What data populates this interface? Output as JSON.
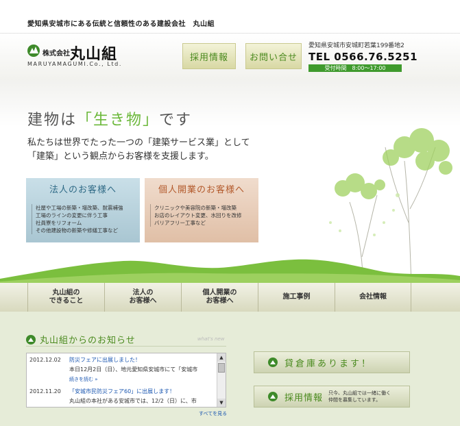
{
  "tagline": "愛知県安城市にある伝統と信頼性のある建設会社　丸山組",
  "logo": {
    "prefix": "株式会社",
    "name": "丸山組",
    "roman": "MARUYAMAGUMI.Co., Ltd."
  },
  "header": {
    "recruit_label": "採用情報",
    "contact_label": "お問い合せ",
    "address": "愛知県安城市安城町若葉199番地2",
    "tel": "TEL 0566.76.5251",
    "hours": "受付時間　8:00～17:00"
  },
  "hero": {
    "headline_before": "建物は",
    "headline_accent": "「生き物」",
    "headline_after": "です",
    "text_line1": "私たちは世界でたった一つの「建築サービス業」として",
    "text_line2": "「建築」という観点からお客様を支援します。"
  },
  "panels": {
    "corp": {
      "title": "法人のお客様へ",
      "items": [
        "社屋や工場の新築・増改築、耐震補強",
        "工場のラインの変更に伴う工事",
        "社員寮をリフォーム",
        "その他建設物の新築や修繕工事など"
      ]
    },
    "indiv": {
      "title": "個人開業のお客様へ",
      "items": [
        "クリニックや美容院の新築・増改築",
        "お店のレイアウト変更、水回りを改修",
        "バリアフリー工事など"
      ]
    }
  },
  "nav": [
    {
      "line1": "丸山組の",
      "line2": "できること"
    },
    {
      "line1": "法人の",
      "line2": "お客様へ"
    },
    {
      "line1": "個人開業の",
      "line2": "お客様へ"
    },
    {
      "line1": "施工事例",
      "line2": ""
    },
    {
      "line1": "会社情報",
      "line2": ""
    }
  ],
  "news": {
    "title": "丸山組からのお知らせ",
    "subtitle": "what's new",
    "entries": [
      {
        "date": "2012.12.02",
        "title": "防災フェアに出展しました！",
        "body": "本日12月2日（日）、地元愛知県安城市にて「安城市",
        "more": "続きを読む »"
      },
      {
        "date": "2012.11.20",
        "title": "「安城市民防災フェア60」に出展します！",
        "body": "丸山組の本社がある安城市では、12/2（日）に、市"
      }
    ],
    "see_all": "すべてを見る"
  },
  "side": {
    "warehouse_label": "貸倉庫あります！",
    "recruit_label": "採用情報",
    "recruit_note_line1": "只今、丸山組では一緒に働く",
    "recruit_note_line2": "仲間を募集しています。"
  },
  "colors": {
    "brand_green": "#3e8a2a",
    "accent_green": "#6bb83a",
    "corp_panel": "#b9d3de",
    "indiv_panel": "#e8ccb6",
    "footer_bg": "#e6ecd8"
  }
}
